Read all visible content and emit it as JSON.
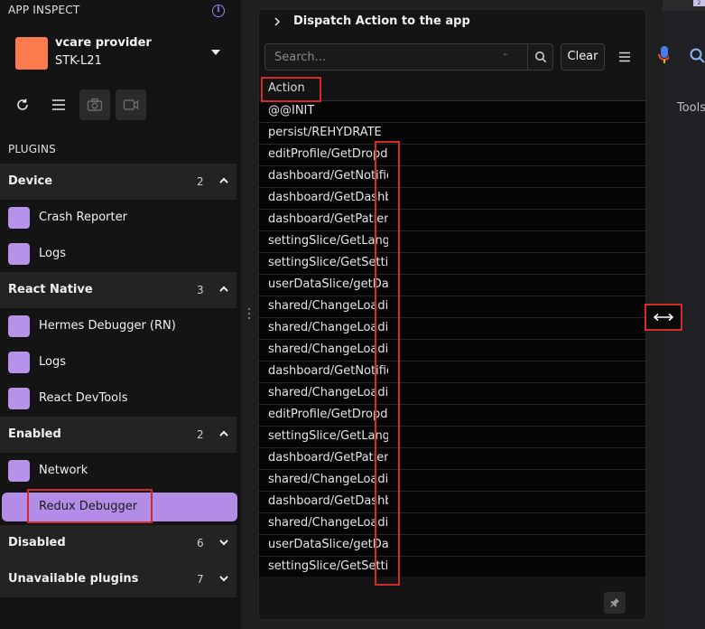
{
  "sidebar": {
    "header": "APP INSPECT",
    "app": {
      "name": "vcare provider",
      "device": "STK-L21",
      "avatar_color": "#fb7a4e"
    },
    "plugins_label": "PLUGINS",
    "groups": {
      "device": {
        "title": "Device",
        "count": "2",
        "items": [
          {
            "label": "Crash Reporter"
          },
          {
            "label": "Logs"
          }
        ]
      },
      "react_native": {
        "title": "React Native",
        "count": "3",
        "items": [
          {
            "label": "Hermes Debugger (RN)"
          },
          {
            "label": "Logs"
          },
          {
            "label": "React DevTools"
          }
        ]
      },
      "enabled": {
        "title": "Enabled",
        "count": "2",
        "items": [
          {
            "label": "Network"
          },
          {
            "label": "Redux Debugger"
          }
        ]
      },
      "disabled": {
        "title": "Disabled",
        "count": "6"
      },
      "unavailable": {
        "title": "Unavailable plugins",
        "count": "7"
      }
    },
    "accent_color": "#b38ce8"
  },
  "dispatch": {
    "title": "Dispatch Action to the app"
  },
  "search": {
    "placeholder": "Search...",
    "clear_glyph": "⌁"
  },
  "toolbar": {
    "clear_label": "Clear"
  },
  "table": {
    "header": "Action",
    "rows": [
      "@@INIT",
      "persist/REHYDRATE",
      "editProfile/GetDropdo",
      "dashboard/GetNotific",
      "dashboard/GetDashbo",
      "dashboard/GetPatient",
      "settingSlice/GetLangu",
      "settingSlice/GetSettin",
      "userDataSlice/getData",
      "shared/ChangeLoadin",
      "shared/ChangeLoadin",
      "shared/ChangeLoadin",
      "dashboard/GetNotific",
      "shared/ChangeLoadin",
      "editProfile/GetDropdo",
      "settingSlice/GetLangu",
      "dashboard/GetPatient",
      "shared/ChangeLoadin",
      "dashboard/GetDashbo",
      "shared/ChangeLoadin",
      "userDataSlice/getData",
      "settingSlice/GetSettin"
    ]
  },
  "background": {
    "tools_label": "Tools",
    "tab_badge": "2"
  }
}
